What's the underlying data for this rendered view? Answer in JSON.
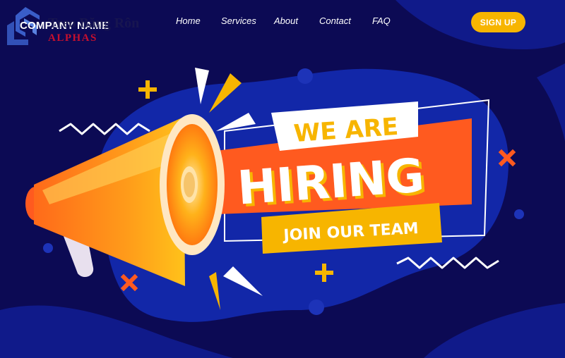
{
  "header": {
    "logo": {
      "company": "COMPANY NAME",
      "overlay_text": "Treo Băng Rôn",
      "sub_text": "ALPHAS"
    },
    "nav": [
      {
        "label": "Home"
      },
      {
        "label": "Services"
      },
      {
        "label": "About"
      },
      {
        "label": "Contact"
      },
      {
        "label": "FAQ"
      }
    ],
    "signup_label": "SIGN UP"
  },
  "hero": {
    "line1": "WE ARE",
    "line2": "HIRING",
    "line3": "JOIN OUR TEAM"
  },
  "colors": {
    "background": "#0c0a54",
    "blob": "#1227a8",
    "accent_yellow": "#f7b500",
    "accent_orange": "#ff5a1f",
    "white": "#ffffff"
  },
  "icons": [
    "megaphone-icon",
    "plus-icon",
    "cross-icon",
    "zigzag-decoration",
    "logo-icon"
  ]
}
